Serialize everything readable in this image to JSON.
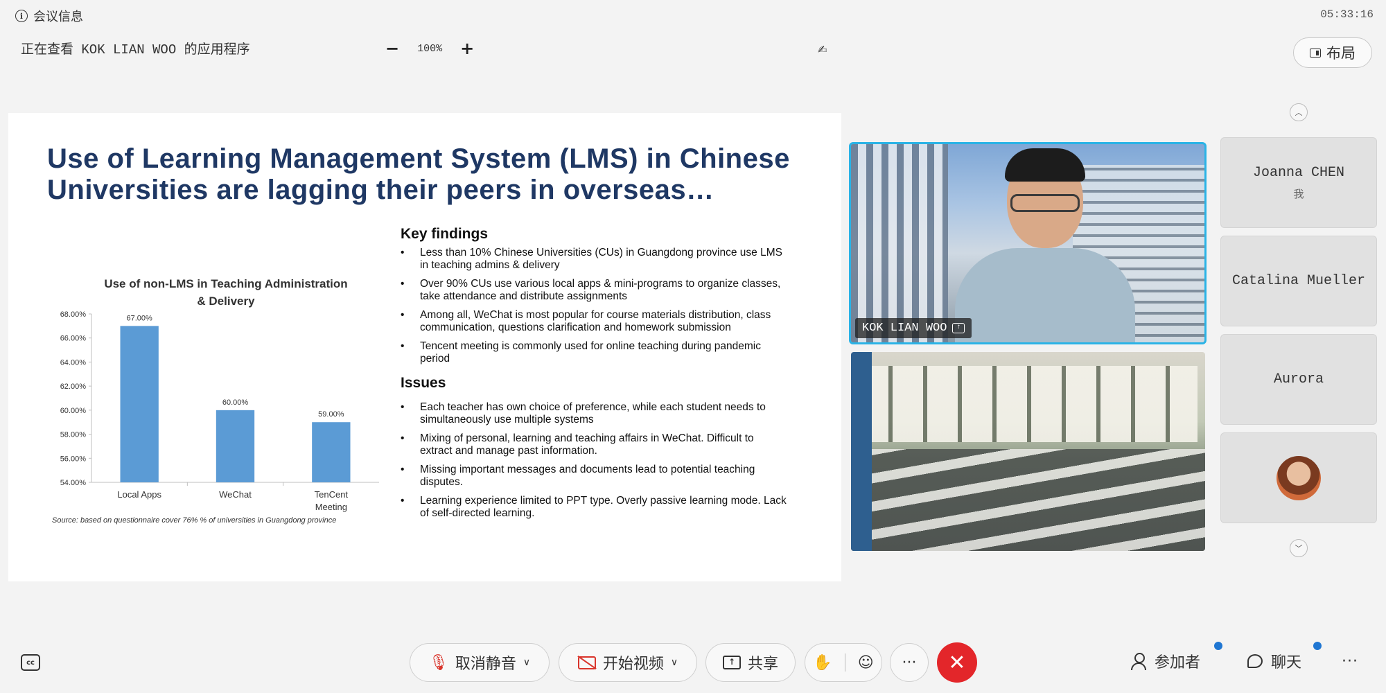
{
  "header": {
    "meeting_info": "会议信息",
    "clock": "05:33:16",
    "viewing": "正在查看 KOK LIAN WOO 的应用程序",
    "zoom": "100%",
    "layout": "布局"
  },
  "slide": {
    "title": "Use of Learning Management System (LMS) in Chinese Universities are lagging their peers in overseas…",
    "source": "Source: based on questionnaire cover 76% % of universities in Guangdong province",
    "key_findings_heading": "Key findings",
    "key_findings": [
      "Less than 10% Chinese Universities (CUs) in Guangdong province use LMS in teaching admins & delivery",
      "Over 90% CUs use various local apps & mini-programs to organize classes, take attendance and distribute assignments",
      "Among all, WeChat is most popular for course materials distribution, class communication, questions clarification  and homework submission",
      "Tencent meeting is commonly used for online teaching during pandemic period"
    ],
    "issues_heading": "Issues",
    "issues": [
      "Each teacher has own choice of preference, while each student needs to simultaneously use multiple systems",
      "Mixing of personal, learning and teaching affairs in WeChat. Difficult to extract and manage past information.",
      "Missing important messages and documents lead to potential teaching disputes.",
      "Learning experience limited to PPT type. Overly passive learning mode. Lack of self-directed learning."
    ]
  },
  "chart_data": {
    "type": "bar",
    "title": "Use of non-LMS in Teaching Administration & Delivery",
    "categories": [
      "Local Apps",
      "WeChat",
      "TenCent Meeting"
    ],
    "values": [
      67.0,
      60.0,
      59.0
    ],
    "data_labels": [
      "67.00%",
      "60.00%",
      "59.00%"
    ],
    "ylim": [
      54,
      68
    ],
    "yticks": [
      "54.00%",
      "56.00%",
      "58.00%",
      "60.00%",
      "62.00%",
      "64.00%",
      "66.00%",
      "68.00%"
    ],
    "bar_color": "#5b9bd5",
    "grid": false,
    "legend": "none"
  },
  "videos": {
    "speaker_name": "KOK LIAN WOO",
    "speaker_border_color": "#2ab3e6"
  },
  "participants": [
    {
      "name": "Joanna CHEN",
      "tag": "我"
    },
    {
      "name": "Catalina Mueller"
    },
    {
      "name": "Aurora"
    },
    {
      "name": ""
    }
  ],
  "toolbar": {
    "mute": "取消静音",
    "video": "开始视频",
    "share": "共享",
    "participants": "参加者",
    "chat": "聊天",
    "more": "···",
    "end_color": "#e3262a",
    "badge_color": "#1f76d2"
  },
  "icons": [
    "info-icon",
    "zoom-out-icon",
    "zoom-in-icon",
    "pen-icon",
    "layout-icon",
    "scroll-up-icon",
    "scroll-down-icon",
    "captions-icon",
    "mic-off-icon",
    "video-off-icon",
    "share-icon",
    "raise-hand-icon",
    "reaction-icon",
    "more-icon",
    "end-call-icon",
    "participants-icon",
    "chat-icon"
  ]
}
